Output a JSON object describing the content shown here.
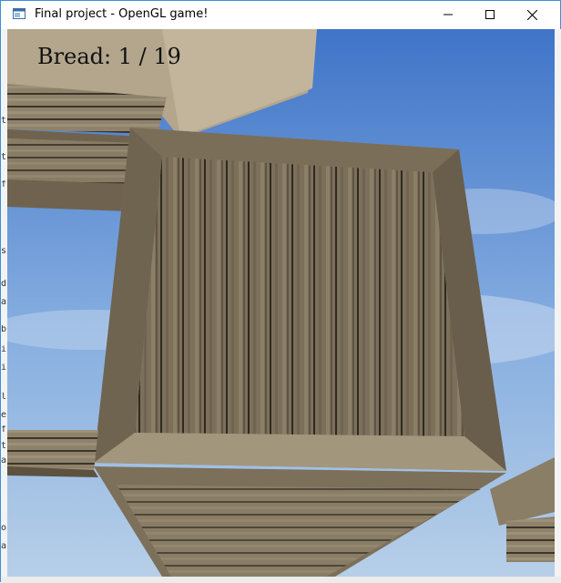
{
  "window": {
    "title": "Final project - OpenGL game!",
    "minimize_icon": "minimize-icon",
    "maximize_icon": "maximize-icon",
    "close_icon": "close-icon",
    "border_color": "#3c8fd6"
  },
  "hud": {
    "bread_counter": "Bread: 1 / 19"
  },
  "scene": {
    "sky_color": "#6a98d6",
    "wood_color": "#8a7a62"
  },
  "background_edge_chars": [
    "t",
    "t",
    "f",
    "s",
    "d",
    "a",
    "b",
    "i",
    "i",
    "l",
    "e",
    "f",
    "t",
    "a",
    "o",
    "a"
  ]
}
